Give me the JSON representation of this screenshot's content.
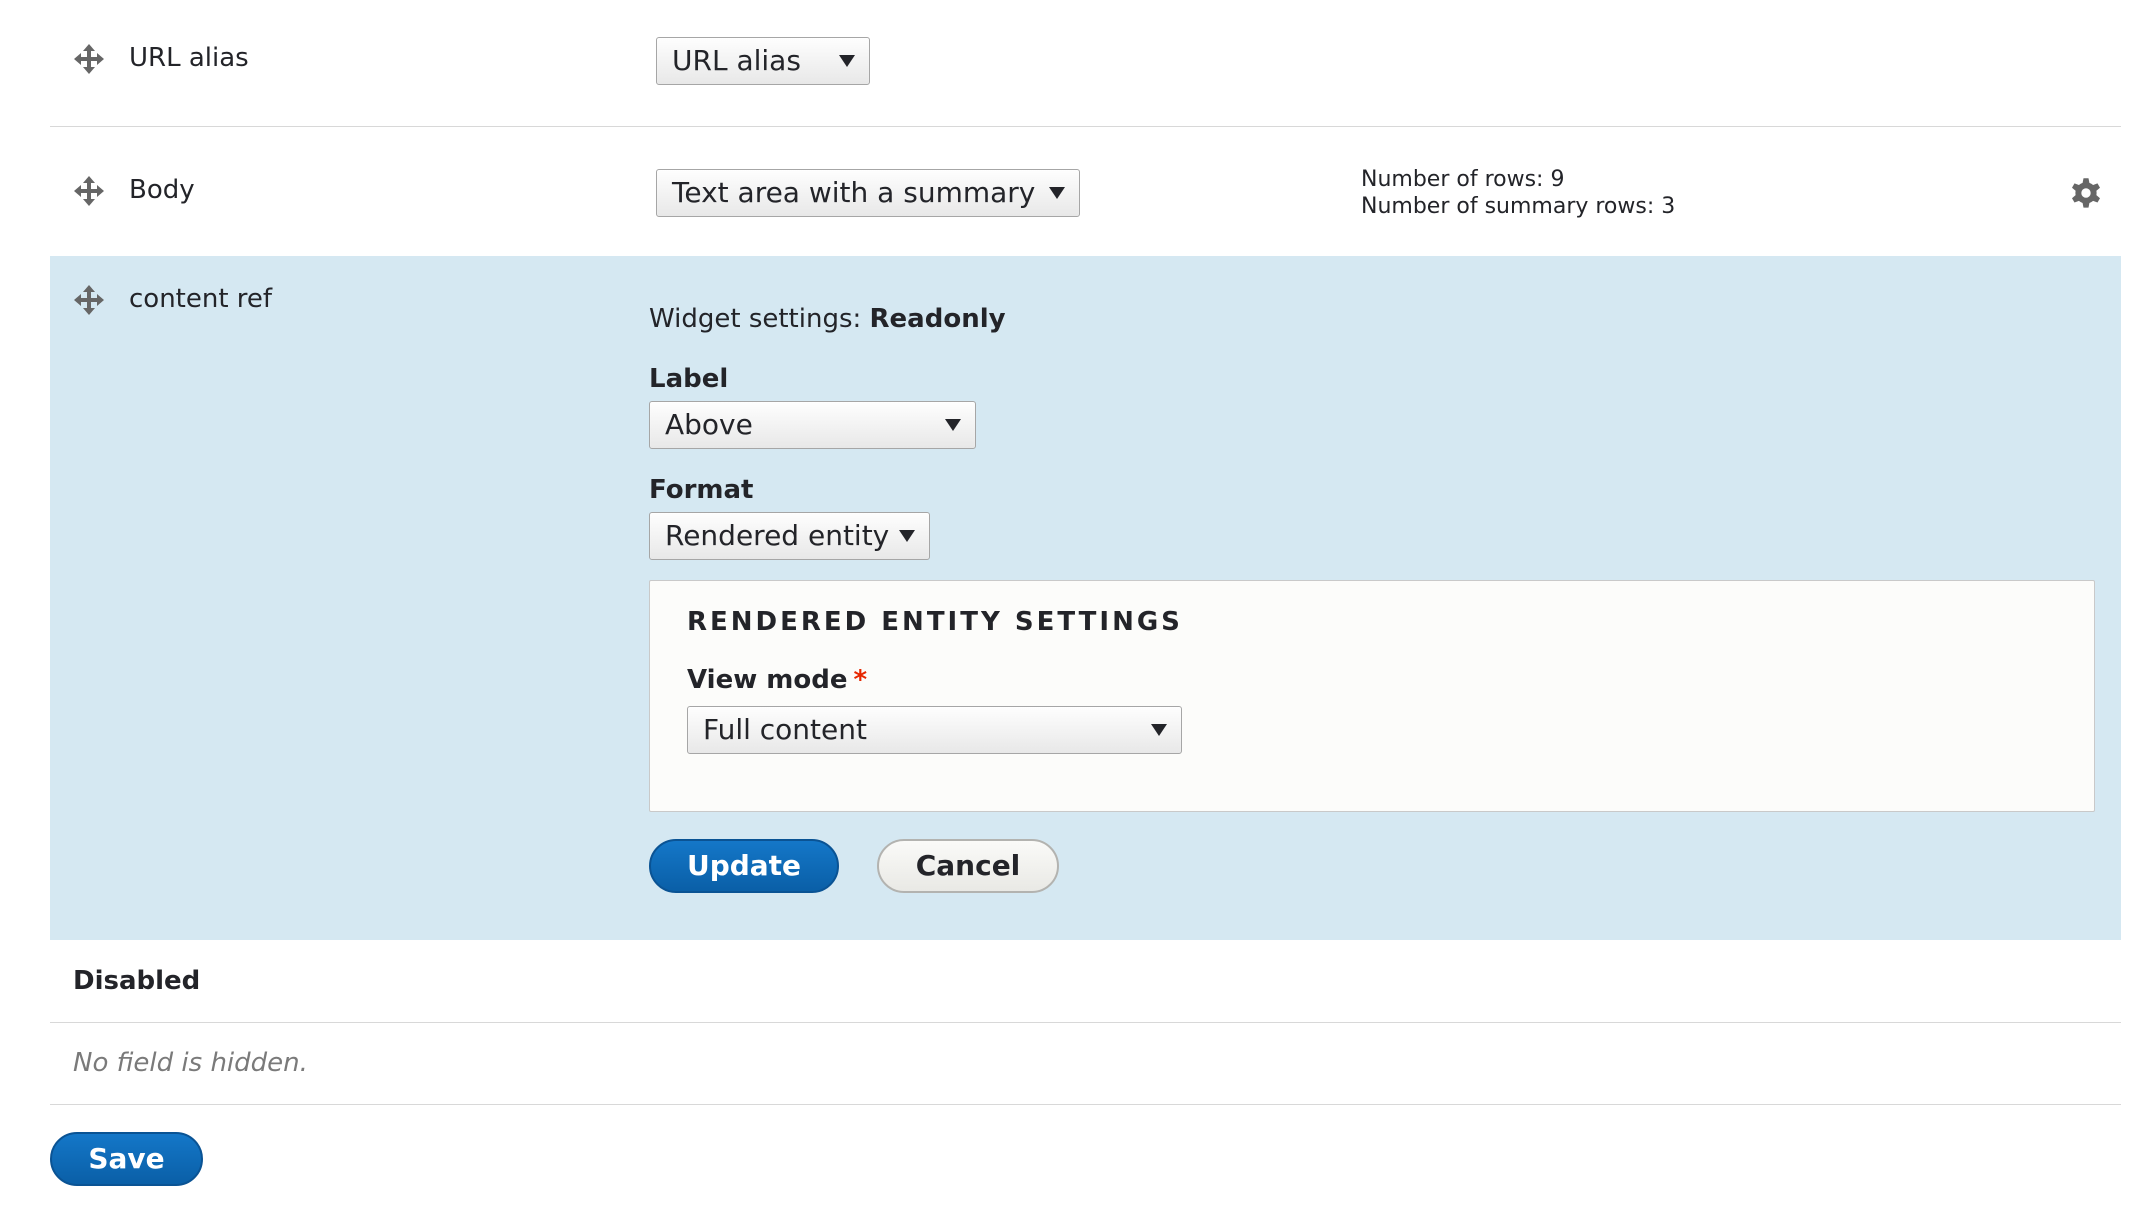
{
  "rows": [
    {
      "field_name": "URL alias",
      "widget": "URL alias"
    },
    {
      "field_name": "Body",
      "widget": "Text area with a summary",
      "summary_line1": "Number of rows: 9",
      "summary_line2": "Number of summary rows: 3"
    }
  ],
  "active_row": {
    "field_name": "content ref",
    "settings_prefix": "Widget settings: ",
    "settings_name": "Readonly",
    "label_label": "Label",
    "label_value": "Above",
    "format_label": "Format",
    "format_value": "Rendered entity",
    "fieldset_title": "RENDERED ENTITY SETTINGS",
    "view_mode_label": "View mode",
    "view_mode_required": "*",
    "view_mode_value": "Full content",
    "update_label": "Update",
    "cancel_label": "Cancel"
  },
  "disabled_section": {
    "title": "Disabled",
    "empty_message": "No field is hidden."
  },
  "save_label": "Save",
  "icons": {
    "drag": "move-arrows-icon",
    "settings": "gear-icon"
  },
  "colors": {
    "active_row_bg": "#d5e8f2",
    "primary_button": "#0f6cbd",
    "required": "#e62600"
  }
}
